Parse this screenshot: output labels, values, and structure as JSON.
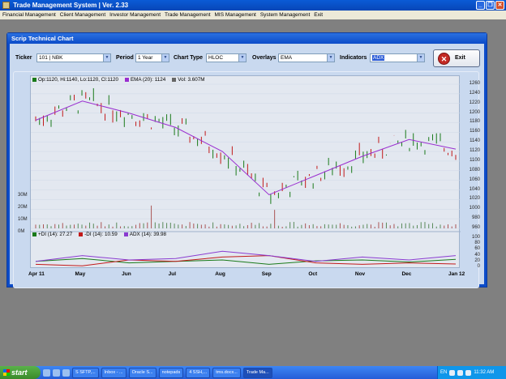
{
  "app": {
    "title": "Trade Management System  |  Ver. 2.33"
  },
  "menu": [
    "Financial Management",
    "Client Management",
    "Investor Management",
    "Trade Management",
    "MIS Management",
    "System Management",
    "Exit"
  ],
  "window": {
    "title": "Scrip Technical Chart"
  },
  "toolbar": {
    "ticker_label": "Ticker",
    "ticker_value": "101 | NBK",
    "period_label": "Period",
    "period_value": "1 Year",
    "charttype_label": "Chart Type",
    "charttype_value": "HLOC",
    "overlays_label": "Overlays",
    "overlays_value": "EMA",
    "indicators_label": "Indicators",
    "indicators_value": "ADX",
    "exit_label": "Exit"
  },
  "chart": {
    "legend_price": "Op:1120, Hi:1140, Lo:1120, Cl:1120",
    "legend_ema": "EMA (20): 1124",
    "legend_vol": "Vol: 3.607M",
    "legend_pdi": "+DI (14): 27.27",
    "legend_mdi": "-DI (14): 10.59",
    "legend_adx": "ADX (14): 39.98",
    "price_ticks": [
      "1260",
      "1240",
      "1220",
      "1200",
      "1180",
      "1160",
      "1140",
      "1120",
      "1100",
      "1080",
      "1060",
      "1040",
      "1020",
      "1000",
      "980",
      "960"
    ],
    "vol_ticks": [
      "30M",
      "20M",
      "10M",
      "0M"
    ],
    "adx_ticks": [
      "100",
      "80",
      "60",
      "40",
      "20",
      "0"
    ],
    "x_ticks": [
      "Apr 11",
      "May",
      "Jun",
      "Jul",
      "Aug",
      "Sep",
      "Oct",
      "Nov",
      "Dec",
      "Jan 12"
    ]
  },
  "chart_data": {
    "type": "line",
    "title": "",
    "x": [
      "Apr 11",
      "May",
      "Jun",
      "Jul",
      "Aug",
      "Sep",
      "Oct",
      "Nov",
      "Dec",
      "Jan 12"
    ],
    "series": [
      {
        "name": "EMA (20)",
        "values": [
          1185,
          1225,
          1200,
          1170,
          1120,
          1030,
          1070,
          1110,
          1145,
          1125
        ]
      },
      {
        "name": "+DI (14)",
        "values": [
          20,
          30,
          15,
          20,
          25,
          10,
          22,
          25,
          18,
          27
        ]
      },
      {
        "name": "-DI (14)",
        "values": [
          10,
          5,
          25,
          20,
          35,
          40,
          15,
          10,
          15,
          11
        ]
      },
      {
        "name": "ADX (14)",
        "values": [
          20,
          40,
          25,
          30,
          55,
          40,
          20,
          35,
          25,
          40
        ]
      }
    ],
    "ylim": [
      960,
      1260
    ]
  },
  "colors": {
    "ema": "#9a2ed0",
    "up": "#1a7a1a",
    "down": "#c21a1a",
    "adx": "#8a3bd0"
  },
  "taskbar": {
    "start": "start",
    "tasks": [
      "S SFTP,...",
      "Inbox - ...",
      "Oracle S...",
      "notepads",
      "4 SSH,...",
      "tms.docx...",
      "Trade Ma..."
    ],
    "tray_lang": "EN",
    "clock": "11:32 AM"
  }
}
